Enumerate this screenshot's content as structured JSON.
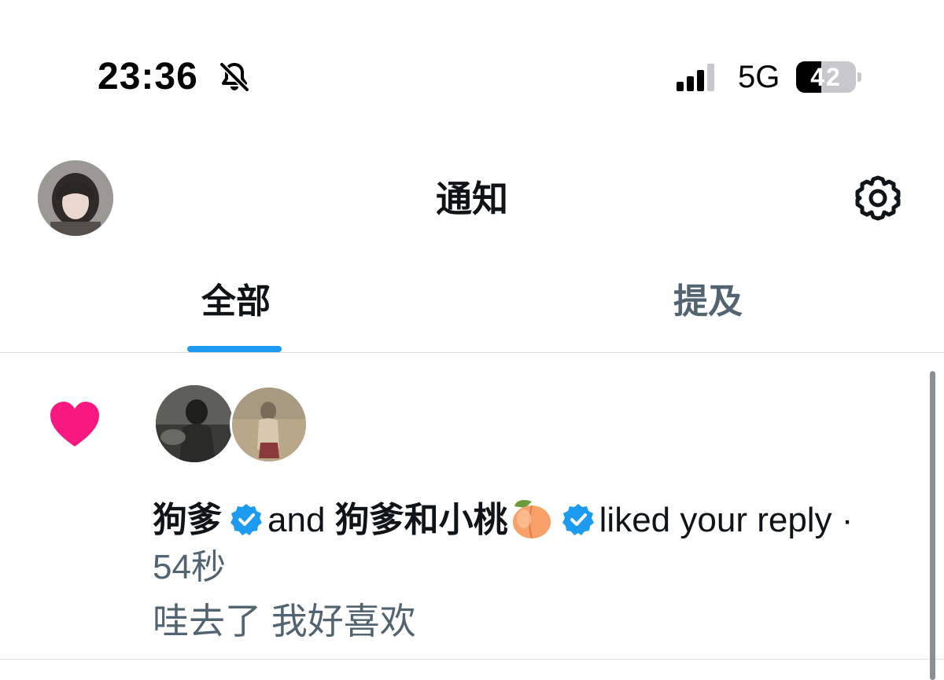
{
  "status_bar": {
    "time": "23:36",
    "network": "5G",
    "battery": "42",
    "battery_level_percent": 42,
    "bell_icon": "bell-slash-icon",
    "signal_icon": "cellular-signal-icon"
  },
  "header": {
    "title": "通知",
    "settings_icon": "gear-icon",
    "avatar": "profile-avatar"
  },
  "tabs": [
    {
      "label": "全部",
      "active": true
    },
    {
      "label": "提及",
      "active": false
    }
  ],
  "notification": {
    "icon": "heart-icon",
    "user1": "狗爹",
    "connector": "and",
    "user2": "狗爹和小桃",
    "action": "liked your reply ·",
    "time": "54秒",
    "reply_text": "哇去了 我好喜欢"
  },
  "colors": {
    "accent": "#1d9bf0",
    "heart": "#f91880",
    "secondary_text": "#536471",
    "verified": "#1d9bf0"
  }
}
